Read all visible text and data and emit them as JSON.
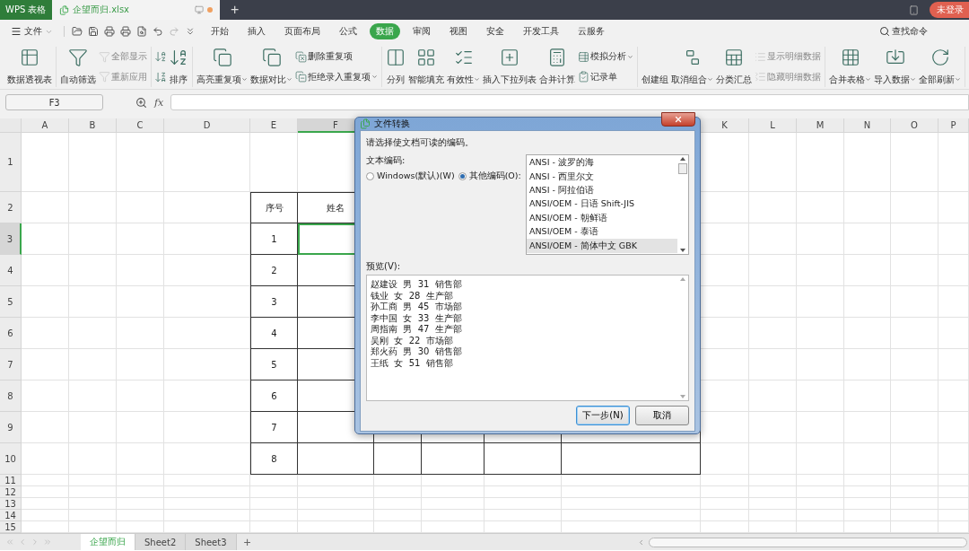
{
  "title_bar": {
    "app_tab": "WPS 表格",
    "doc_tab": {
      "label": "企望而归.xlsx",
      "modified": true
    },
    "new_tab": "+",
    "login": "未登录"
  },
  "menu": {
    "file": "文件",
    "tabs": [
      {
        "label": "开始",
        "selected": false
      },
      {
        "label": "插入",
        "selected": false
      },
      {
        "label": "页面布局",
        "selected": false
      },
      {
        "label": "公式",
        "selected": false
      },
      {
        "label": "数据",
        "selected": true
      },
      {
        "label": "审阅",
        "selected": false
      },
      {
        "label": "视图",
        "selected": false
      },
      {
        "label": "安全",
        "selected": false
      },
      {
        "label": "开发工具",
        "selected": false
      },
      {
        "label": "云服务",
        "selected": false
      }
    ],
    "search": "查找命令"
  },
  "ribbon": {
    "groups": [
      {
        "items": [
          {
            "kind": "large",
            "label": "数据透视表",
            "disabled": false,
            "dropdown": false
          }
        ]
      },
      {
        "items": [
          {
            "kind": "large",
            "label": "自动筛选",
            "disabled": false,
            "dropdown": false
          },
          {
            "kind": "pair",
            "items": [
              {
                "label": "全部显示",
                "disabled": true,
                "dropdown": false
              },
              {
                "label": "重新应用",
                "disabled": true,
                "dropdown": false
              }
            ]
          }
        ]
      },
      {
        "items": [
          {
            "kind": "icon_pair"
          },
          {
            "kind": "large",
            "label": "排序",
            "disabled": false,
            "dropdown": false
          }
        ]
      },
      {
        "items": [
          {
            "kind": "large",
            "label": "高亮重复项",
            "disabled": false,
            "dropdown": true
          },
          {
            "kind": "large",
            "label": "数据对比",
            "disabled": false,
            "dropdown": true
          },
          {
            "kind": "pair",
            "items": [
              {
                "label": "删除重复项",
                "disabled": false,
                "dropdown": false
              },
              {
                "label": "拒绝录入重复项",
                "disabled": false,
                "dropdown": true
              }
            ]
          }
        ]
      },
      {
        "items": [
          {
            "kind": "large",
            "label": "分列",
            "disabled": false,
            "dropdown": false
          },
          {
            "kind": "large",
            "label": "智能填充",
            "disabled": false,
            "dropdown": false
          },
          {
            "kind": "large",
            "label": "有效性",
            "disabled": false,
            "dropdown": true
          },
          {
            "kind": "large",
            "label": "插入下拉列表",
            "disabled": false,
            "dropdown": false
          },
          {
            "kind": "large",
            "label": "合并计算",
            "disabled": false,
            "dropdown": false
          },
          {
            "kind": "pair",
            "items": [
              {
                "label": "模拟分析",
                "disabled": false,
                "dropdown": true
              },
              {
                "label": "记录单",
                "disabled": false,
                "dropdown": false
              }
            ]
          }
        ]
      },
      {
        "items": [
          {
            "kind": "large",
            "label": "创建组",
            "disabled": false,
            "dropdown": false
          },
          {
            "kind": "large",
            "label": "取消组合",
            "disabled": false,
            "dropdown": true
          },
          {
            "kind": "large",
            "label": "分类汇总",
            "disabled": false,
            "dropdown": false
          },
          {
            "kind": "pair",
            "items": [
              {
                "label": "显示明细数据",
                "disabled": true,
                "dropdown": false
              },
              {
                "label": "隐藏明细数据",
                "disabled": true,
                "dropdown": false
              }
            ]
          }
        ]
      },
      {
        "items": [
          {
            "kind": "large",
            "label": "合并表格",
            "disabled": false,
            "dropdown": true
          },
          {
            "kind": "large",
            "label": "导入数据",
            "disabled": false,
            "dropdown": true
          },
          {
            "kind": "large",
            "label": "全部刷新",
            "disabled": false,
            "dropdown": true
          }
        ]
      }
    ]
  },
  "formula_bar": {
    "name_box": "F3",
    "fx": "fx"
  },
  "sheet": {
    "columns_left": [
      {
        "label": "A",
        "selected": false
      },
      {
        "label": "B",
        "selected": false
      },
      {
        "label": "C",
        "selected": false
      },
      {
        "label": "D",
        "selected": false
      },
      {
        "label": "E",
        "selected": false
      },
      {
        "label": "F",
        "selected": true
      }
    ],
    "columns_right": [
      {
        "label": "K",
        "selected": false
      },
      {
        "label": "L",
        "selected": false
      },
      {
        "label": "M",
        "selected": false
      },
      {
        "label": "N",
        "selected": false
      },
      {
        "label": "O",
        "selected": false
      },
      {
        "label": "P",
        "selected": false
      }
    ],
    "rows": [
      {
        "label": "1",
        "selected": false
      },
      {
        "label": "2",
        "selected": false
      },
      {
        "label": "3",
        "selected": true
      },
      {
        "label": "4",
        "selected": false
      },
      {
        "label": "5",
        "selected": false
      },
      {
        "label": "6",
        "selected": false
      },
      {
        "label": "7",
        "selected": false
      },
      {
        "label": "8",
        "selected": false
      },
      {
        "label": "9",
        "selected": false
      },
      {
        "label": "10",
        "selected": false
      },
      {
        "label": "11",
        "selected": false
      },
      {
        "label": "12",
        "selected": false
      },
      {
        "label": "13",
        "selected": false
      },
      {
        "label": "14",
        "selected": false
      },
      {
        "label": "15",
        "selected": false
      }
    ],
    "table": {
      "rows": [
        [
          "序号",
          "姓名"
        ],
        [
          "1"
        ],
        [
          "2"
        ],
        [
          "3"
        ],
        [
          "4"
        ],
        [
          "5"
        ],
        [
          "6"
        ],
        [
          "7"
        ],
        [
          "8"
        ]
      ]
    }
  },
  "dialog": {
    "title": "文件转换",
    "prompt": "请选择使文档可读的编码。",
    "encoding_label": "文本编码:",
    "radios": [
      {
        "label": "Windows(默认)(W)",
        "selected": false
      },
      {
        "label": "其他编码(O):",
        "selected": true
      }
    ],
    "encodings": [
      {
        "label": "ANSI - 波罗的海",
        "selected": false
      },
      {
        "label": "ANSI - 西里尔文",
        "selected": false
      },
      {
        "label": "ANSI - 阿拉伯语",
        "selected": false
      },
      {
        "label": "ANSI/OEM - 日语 Shift-JIS",
        "selected": false
      },
      {
        "label": "ANSI/OEM - 朝鲜语",
        "selected": false
      },
      {
        "label": "ANSI/OEM - 泰语",
        "selected": false
      },
      {
        "label": "ANSI/OEM - 简体中文 GBK",
        "selected": true
      }
    ],
    "preview_label": "预览(V):",
    "preview": [
      "赵建设  男  31  销售部",
      "钱业  女  28  生产部",
      "孙工商  男  45  市场部",
      "李中国  女  33  生产部",
      "周指南  男  47  生产部",
      "吴刚  女  22  市场部",
      "郑火药  男  30  销售部",
      "王纸  女  51  销售部"
    ],
    "buttons": [
      {
        "label": "下一步(N)",
        "kind": "primary"
      },
      {
        "label": "取消",
        "kind": "normal"
      }
    ]
  },
  "sheet_tabs": [
    {
      "label": "企望而归",
      "selected": true
    },
    {
      "label": "Sheet2",
      "selected": false
    },
    {
      "label": "Sheet3",
      "selected": false
    }
  ],
  "add_sheet": "+"
}
